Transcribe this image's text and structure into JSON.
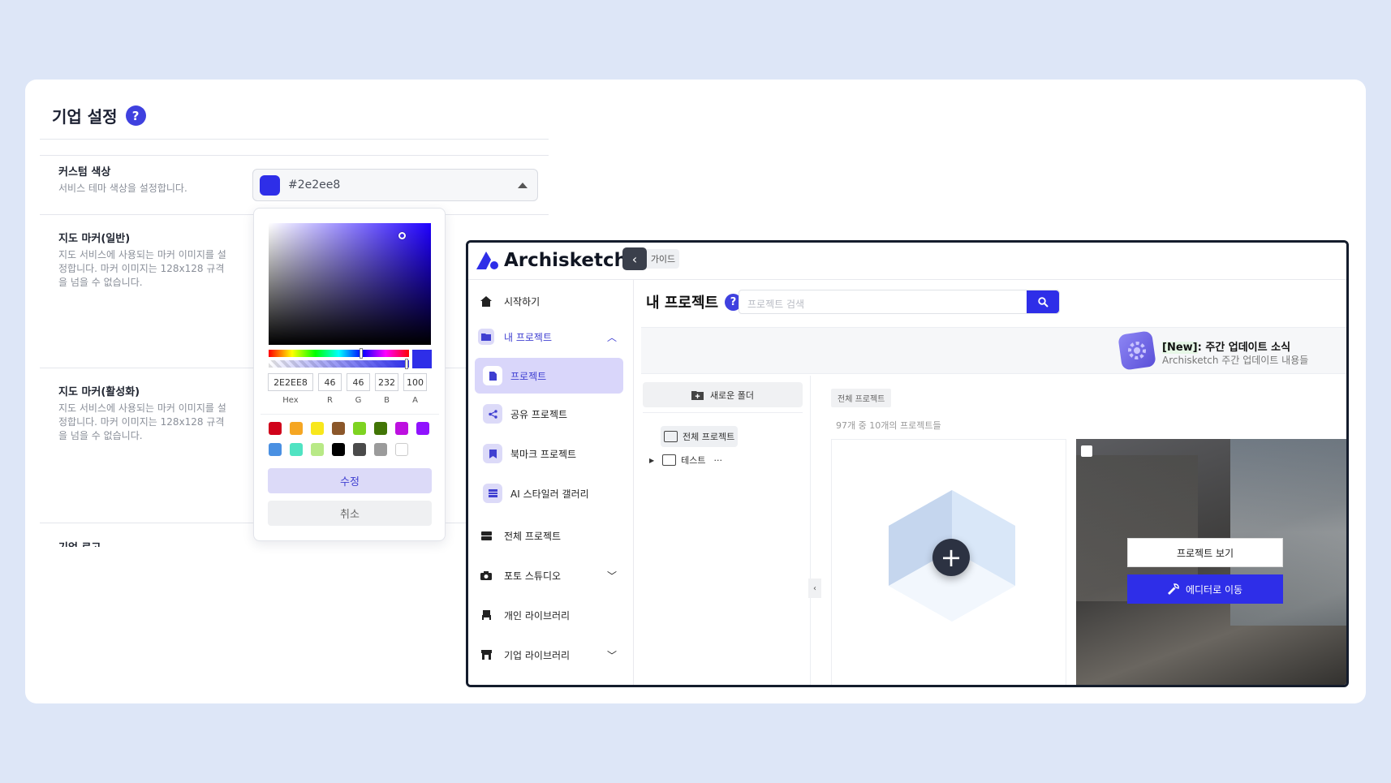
{
  "settings": {
    "title": "기업 설정",
    "help": "?",
    "custom_color": {
      "title": "커스텀 색상",
      "desc": "서비스 테마 색상을 설정합니다.",
      "value": "#2e2ee8"
    },
    "marker_normal": {
      "title": "지도 마커(일반)",
      "desc": "지도 서비스에 사용되는 마커 이미지를 설정합니다. 마커 이미지는 128x128 규격을 넘을 수 없습니다."
    },
    "marker_active": {
      "title": "지도 마커(활성화)",
      "desc": "지도 서비스에 사용되는 마커 이미지를 설정합니다. 마커 이미지는 128x128 규격을 넘을 수 없습니다."
    },
    "logo_partial": "기업 로고"
  },
  "picker": {
    "hex": "2E2EE8",
    "r": "46",
    "g": "46",
    "b": "232",
    "a": "100",
    "labels": {
      "hex": "Hex",
      "r": "R",
      "g": "G",
      "b": "B",
      "a": "A"
    },
    "swatches": [
      "#d0021b",
      "#f5a623",
      "#f8e71c",
      "#8b572a",
      "#7ed321",
      "#417505",
      "#bd10e0",
      "#9013fe",
      "#4a90e2",
      "#50e3c2",
      "#b8e986",
      "#000000",
      "#4a4a4a",
      "#9b9b9b",
      "#ffffff"
    ],
    "save": "수정",
    "cancel": "취소"
  },
  "app": {
    "brand": "Archisketch",
    "back": "‹",
    "guide": "가이드",
    "nav": {
      "start": "시작하기",
      "my_projects": "내 프로젝트",
      "projects": "프로젝트",
      "shared": "공유 프로젝트",
      "bookmark": "북마크 프로젝트",
      "ai_gallery": "AI 스타일러 갤러리",
      "all_projects": "전체 프로젝트",
      "photo_studio": "포토 스튜디오",
      "personal_library": "개인 라이브러리",
      "company_library": "기업 라이브러리"
    },
    "page_title": "내 프로젝트",
    "help": "?",
    "search_placeholder": "프로젝트 검색",
    "banner": {
      "tag": "[New]",
      "title": ": 주간 업데이트 소식",
      "subtitle": "Archisketch 주간 업데이트 내용들"
    },
    "new_folder": "새로운 폴더",
    "folders": {
      "all": "전체 프로젝트",
      "test": "테스트",
      "more": "···"
    },
    "filter_chip": "전체 프로젝트",
    "count_text": "97개 중 10개의 프로젝트들",
    "card": {
      "view": "프로젝트 보기",
      "edit": "에디터로 이동"
    }
  }
}
